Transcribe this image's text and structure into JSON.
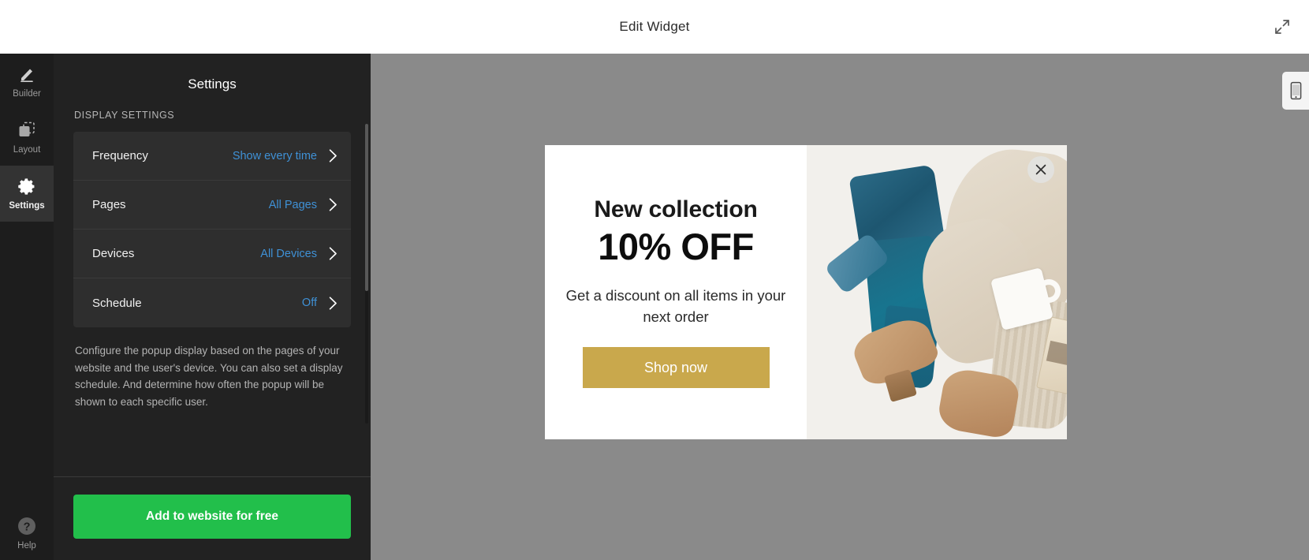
{
  "header": {
    "title": "Edit Widget",
    "expand_icon": "expand-arrows-icon"
  },
  "sidebar": {
    "items": [
      {
        "label": "Builder",
        "icon": "pencil-icon",
        "active": false
      },
      {
        "label": "Layout",
        "icon": "layout-icon",
        "active": false
      },
      {
        "label": "Settings",
        "icon": "gear-icon",
        "active": true
      }
    ],
    "help": {
      "label": "Help",
      "icon": "question-circle-icon"
    }
  },
  "panel": {
    "title": "Settings",
    "section_label": "DISPLAY SETTINGS",
    "rows": [
      {
        "label": "Frequency",
        "value": "Show every time",
        "chevron": "chevron-right-icon"
      },
      {
        "label": "Pages",
        "value": "All Pages",
        "chevron": "chevron-right-icon"
      },
      {
        "label": "Devices",
        "value": "All Devices",
        "chevron": "chevron-right-icon"
      },
      {
        "label": "Schedule",
        "value": "Off",
        "chevron": "chevron-right-icon"
      }
    ],
    "description": "Configure the popup display based on the pages of your website and the user's device. You can also set a display schedule. And determine how often the popup will be shown to each specific user.",
    "cta_label": "Add to website for free"
  },
  "canvas": {
    "device_toggle_icon": "mobile-phone-icon",
    "background_color": "#8a8a8a"
  },
  "popup": {
    "heading": "New collection",
    "discount": "10% OFF",
    "subtitle": "Get a discount on all items in your next order",
    "cta_label": "Shop now",
    "close_icon": "close-x-icon",
    "image_alt": "Flat lay of folded blue jeans, cream knit sweater, tan suede ankle boots, white mug and a paper tag on white linen"
  },
  "colors": {
    "accent_blue": "#3f91d6",
    "cta_green": "#22bf4b",
    "popup_gold": "#c9a84c",
    "panel_bg": "#222222",
    "rail_bg": "#1d1d1d"
  }
}
